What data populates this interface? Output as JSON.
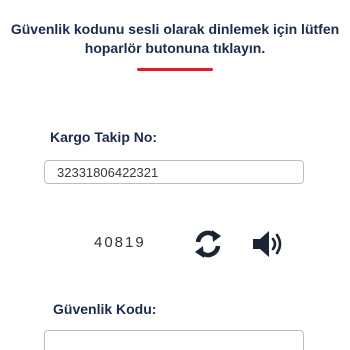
{
  "instruction": {
    "text": "Güvenlik kodunu sesli olarak dinlemek için lütfen hoparlör butonuna tıklayın."
  },
  "tracking": {
    "label": "Kargo Takip No:",
    "value": "32331806422321"
  },
  "captcha": {
    "code": "40819",
    "refresh_icon": "refresh-icon",
    "speaker_icon": "speaker-icon"
  },
  "security": {
    "label": "Güvenlik Kodu:",
    "value": ""
  },
  "colors": {
    "heading": "#1a2b4c",
    "accent_red": "#e31b23",
    "icon": "#1a2433",
    "border": "#b9bec6"
  }
}
